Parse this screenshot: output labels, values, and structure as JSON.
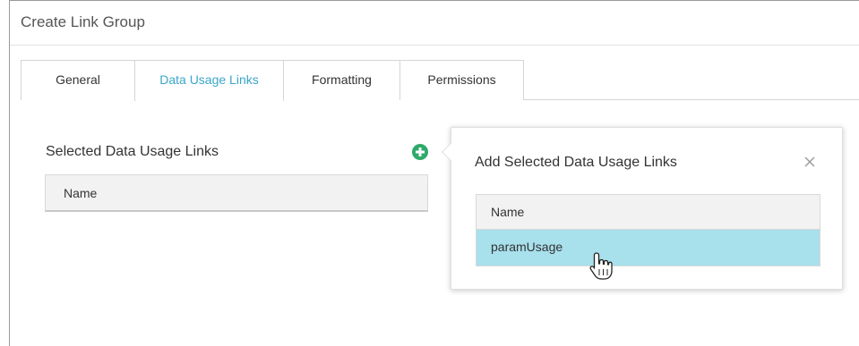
{
  "dialog": {
    "title": "Create Link Group"
  },
  "tabs": [
    {
      "label": "General"
    },
    {
      "label": "Data Usage Links",
      "active": true
    },
    {
      "label": "Formatting"
    },
    {
      "label": "Permissions"
    }
  ],
  "selected_links": {
    "title": "Selected Data Usage Links",
    "columns": [
      "Name"
    ]
  },
  "add_popover": {
    "title": "Add Selected Data Usage Links",
    "columns": [
      "Name"
    ],
    "rows": [
      {
        "name": "paramUsage",
        "highlighted": true
      }
    ]
  },
  "icons": {
    "add": "plus-circle-icon",
    "close": "close-icon",
    "cursor": "hand-pointer-icon"
  },
  "colors": {
    "accent": "#3aa6c9",
    "add_green": "#2eaa6a",
    "row_highlight": "#a8e0ec"
  }
}
